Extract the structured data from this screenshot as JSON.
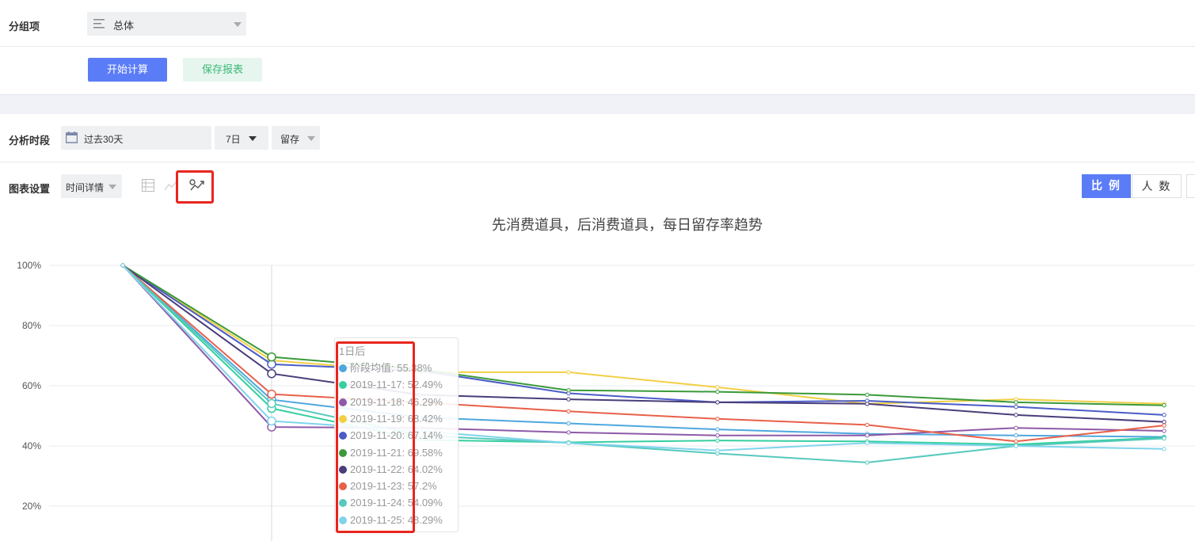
{
  "group": {
    "label": "分组项",
    "select_value": "总体"
  },
  "actions": {
    "start_label": "开始计算",
    "save_label": "保存报表"
  },
  "period": {
    "label": "分析时段",
    "date_value": "过去30天",
    "day_value": "7日",
    "metric_value": "留存"
  },
  "chart_settings": {
    "label": "图表设置",
    "detail_value": "时间详情"
  },
  "view_toggle": {
    "ratio_label": "比 例",
    "count_label": "人 数"
  },
  "tooltip": {
    "title": "1日后",
    "rows": [
      {
        "name": "阶段均值",
        "value": "55.38%",
        "text": "阶段均值: 55.38%"
      },
      {
        "name": "2019-11-17",
        "value": "52.49%",
        "text": "2019-11-17: 52.49%"
      },
      {
        "name": "2019-11-18",
        "value": "46.29%",
        "text": "2019-11-18: 46.29%"
      },
      {
        "name": "2019-11-19",
        "value": "68.42%",
        "text": "2019-11-19: 68.42%"
      },
      {
        "name": "2019-11-20",
        "value": "67.14%",
        "text": "2019-11-20: 67.14%"
      },
      {
        "name": "2019-11-21",
        "value": "69.58%",
        "text": "2019-11-21: 69.58%"
      },
      {
        "name": "2019-11-22",
        "value": "64.02%",
        "text": "2019-11-22: 64.02%"
      },
      {
        "name": "2019-11-23",
        "value": "57.2%",
        "text": "2019-11-23: 57.2%"
      },
      {
        "name": "2019-11-24",
        "value": "54.09%",
        "text": "2019-11-24: 54.09%"
      },
      {
        "name": "2019-11-25",
        "value": "48.29%",
        "text": "2019-11-25: 48.29%"
      }
    ]
  },
  "chart_data": {
    "type": "line",
    "title": "先消费道具，后消费道具，每日留存率趋势",
    "y_ticks": [
      "100%",
      "80%",
      "60%",
      "40%",
      "20%"
    ],
    "ylim": [
      0,
      100
    ],
    "grid": true,
    "highlight_index": 1,
    "series": [
      {
        "name": "阶段均值",
        "color": "#4ea7df",
        "values": [
          100,
          55.38,
          49.5,
          47.5,
          45.5,
          44,
          43.5,
          43
        ]
      },
      {
        "name": "2019-11-17",
        "color": "#36cfa0",
        "values": [
          100,
          52.49,
          42,
          41.2,
          41.8,
          41.5,
          40.5,
          42.8
        ]
      },
      {
        "name": "2019-11-18",
        "color": "#8e5aa8",
        "values": [
          100,
          46.29,
          46,
          44.5,
          43.5,
          43.5,
          46,
          45
        ]
      },
      {
        "name": "2019-11-19",
        "color": "#f2cf45",
        "values": [
          100,
          68.42,
          64.5,
          64.5,
          59.5,
          54,
          55.5,
          54
        ]
      },
      {
        "name": "2019-11-20",
        "color": "#4a5dc7",
        "values": [
          100,
          67.14,
          65,
          57.5,
          54.5,
          55,
          53,
          50.3
        ]
      },
      {
        "name": "2019-11-21",
        "color": "#3a9a3a",
        "values": [
          100,
          69.58,
          65.5,
          58.5,
          58,
          57,
          54.5,
          53.5
        ]
      },
      {
        "name": "2019-11-22",
        "color": "#4a3d7a",
        "values": [
          100,
          64.02,
          57,
          55.5,
          54.5,
          54,
          50.3,
          48
        ]
      },
      {
        "name": "2019-11-23",
        "color": "#e8604a",
        "values": [
          100,
          57.2,
          54.5,
          51.5,
          49,
          47,
          41.5,
          46.8
        ]
      },
      {
        "name": "2019-11-24",
        "color": "#57c9bd",
        "values": [
          100,
          54.09,
          43.5,
          41,
          37.5,
          34.5,
          40,
          42.5
        ]
      },
      {
        "name": "2019-11-25",
        "color": "#7fd4ec",
        "values": [
          100,
          48.29,
          45,
          41,
          38.5,
          41,
          40,
          39
        ]
      }
    ]
  }
}
